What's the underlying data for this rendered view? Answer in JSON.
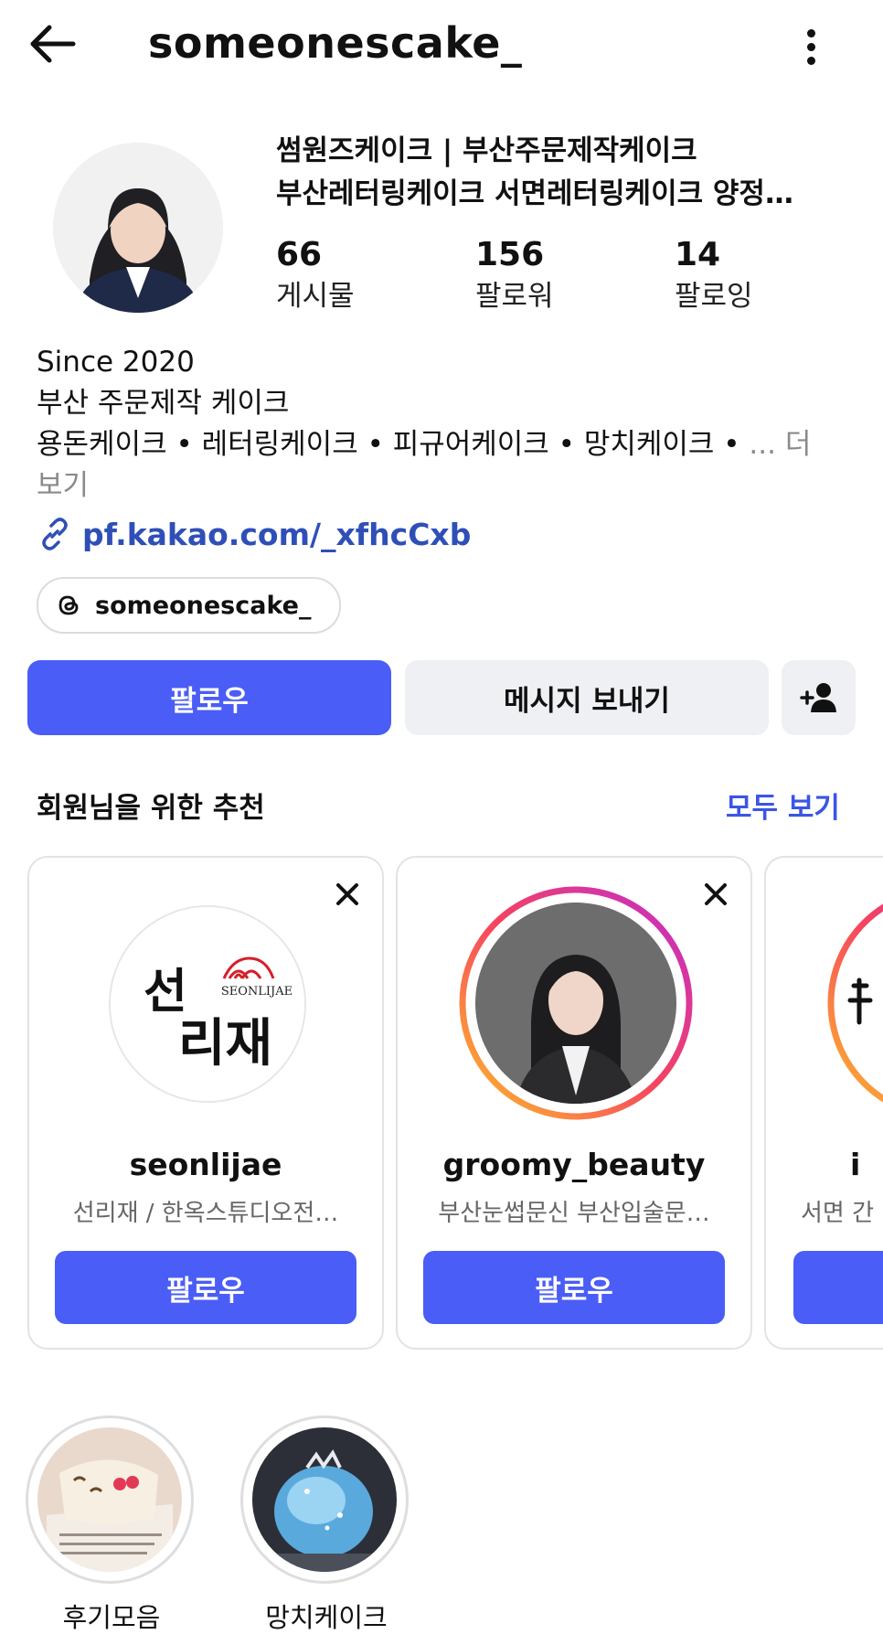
{
  "header": {
    "username": "someonescake_"
  },
  "profile": {
    "display_name_line1": "썸원즈케이크 | 부산주문제작케이크",
    "display_name_line2": "부산레터링케이크 서면레터링케이크 양정…",
    "stats": [
      {
        "value": "66",
        "label": "게시물"
      },
      {
        "value": "156",
        "label": "팔로워"
      },
      {
        "value": "14",
        "label": "팔로잉"
      }
    ],
    "bio_line1": "Since 2020",
    "bio_line2": "부산 주문제작 케이크",
    "bio_line3": "용돈케이크 • 레터링케이크 • 피규어케이크 • 망치케이크 •",
    "bio_more": "... 더 보기",
    "link": "pf.kakao.com/_xfhcCxb",
    "threads_handle": "someonescake_"
  },
  "actions": {
    "follow": "팔로우",
    "message": "메시지 보내기"
  },
  "suggestions": {
    "title": "회원님을 위한 추천",
    "see_all": "모두 보기",
    "cards": [
      {
        "name": "seonlijae",
        "subtitle": "선리재 / 한옥스튜디오전…",
        "follow": "팔로우",
        "logo_text_ko": "선리재",
        "logo_text_en": "SEONLIJAE"
      },
      {
        "name": "groomy_beauty",
        "subtitle": "부산눈썹문신 부산입술문…",
        "follow": "팔로우"
      },
      {
        "name": "i",
        "subtitle": "서면 간"
      }
    ]
  },
  "highlights": [
    {
      "label": "후기모음"
    },
    {
      "label": "망치케이크"
    }
  ],
  "colors": {
    "primary": "#4a5df6",
    "link": "#2f4fb8",
    "see_all": "#3b55e6"
  }
}
